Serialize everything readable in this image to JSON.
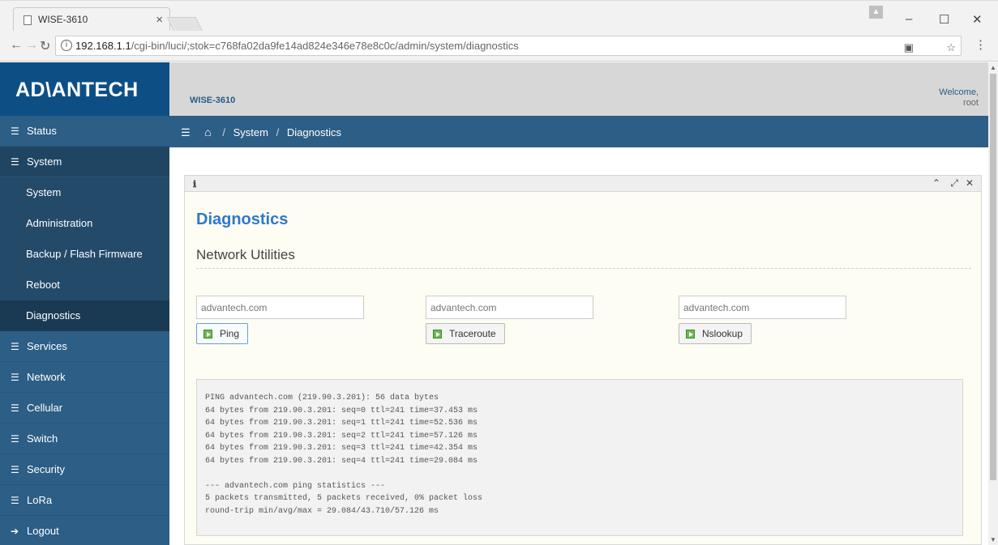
{
  "browser": {
    "tab_title": "WISE-3610",
    "url_host": "192.168.1.1",
    "url_path": "/cgi-bin/luci/;stok=c768fa02da9fe14ad824e346e78e8c0c/admin/system/diagnostics"
  },
  "header": {
    "logo": "AD\\ANTECH",
    "device": "WISE-3610",
    "welcome": "Welcome,",
    "user": "root"
  },
  "sidebar": {
    "items": [
      {
        "label": "Status"
      },
      {
        "label": "System"
      },
      {
        "label": "Services"
      },
      {
        "label": "Network"
      },
      {
        "label": "Cellular"
      },
      {
        "label": "Switch"
      },
      {
        "label": "Security"
      },
      {
        "label": "LoRa"
      },
      {
        "label": "Logout"
      }
    ],
    "system_children": [
      "System",
      "Administration",
      "Backup / Flash Firmware",
      "Reboot",
      "Diagnostics"
    ]
  },
  "breadcrumb": {
    "section": "System",
    "current": "Diagnostics"
  },
  "main": {
    "title": "Diagnostics",
    "section": "Network Utilities",
    "tools": [
      {
        "value": "advantech.com",
        "button": "Ping"
      },
      {
        "value": "advantech.com",
        "button": "Traceroute"
      },
      {
        "value": "advantech.com",
        "button": "Nslookup"
      }
    ],
    "output": [
      "PING advantech.com (219.90.3.201): 56 data bytes",
      "64 bytes from 219.90.3.201: seq=0 ttl=241 time=37.453 ms",
      "64 bytes from 219.90.3.201: seq=1 ttl=241 time=52.536 ms",
      "64 bytes from 219.90.3.201: seq=2 ttl=241 time=57.126 ms",
      "64 bytes from 219.90.3.201: seq=3 ttl=241 time=42.354 ms",
      "64 bytes from 219.90.3.201: seq=4 ttl=241 time=29.084 ms",
      "",
      "--- advantech.com ping statistics ---",
      "5 packets transmitted, 5 packets received, 0% packet loss",
      "round-trip min/avg/max = 29.084/43.710/57.126 ms"
    ]
  },
  "colors": {
    "brand_blue": "#0d4f84",
    "sidebar": "#2c5e86",
    "title_blue": "#2f78c9"
  }
}
